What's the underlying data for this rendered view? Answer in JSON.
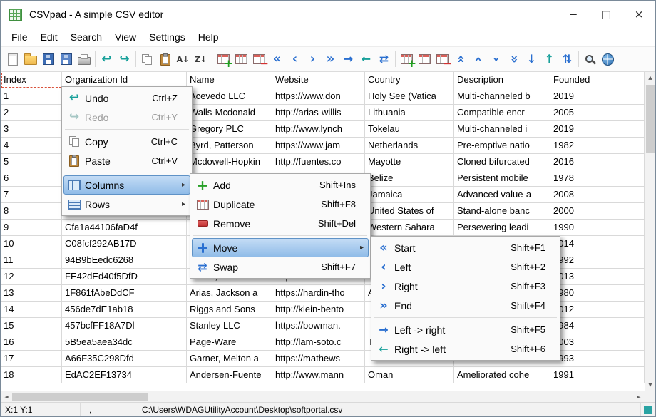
{
  "window": {
    "title": "CSVpad - A simple CSV editor",
    "controls": {
      "minimize": "−",
      "maximize": "□",
      "close": "×"
    }
  },
  "menubar": {
    "items": [
      "File",
      "Edit",
      "Search",
      "View",
      "Settings",
      "Help"
    ]
  },
  "toolbar": {
    "groups": [
      [
        {
          "name": "new-file-button",
          "icon": "new-file-icon"
        },
        {
          "name": "open-button",
          "icon": "open-icon"
        },
        {
          "name": "save-button",
          "icon": "save-icon"
        },
        {
          "name": "save-as-button",
          "icon": "save-as-icon"
        },
        {
          "name": "print-button",
          "icon": "print-icon"
        }
      ],
      [
        {
          "name": "undo-button",
          "icon": "undo-icon"
        },
        {
          "name": "redo-button",
          "icon": "redo-icon"
        }
      ],
      [
        {
          "name": "copy-button",
          "icon": "copy-icon"
        },
        {
          "name": "paste-button",
          "icon": "paste-icon"
        },
        {
          "name": "sort-asc-button",
          "icon": "sort-asc-icon"
        },
        {
          "name": "sort-desc-button",
          "icon": "sort-desc-icon"
        }
      ],
      [
        {
          "name": "col-add-button",
          "icon": "table-add-icon"
        },
        {
          "name": "col-duplicate-button",
          "icon": "table-icon"
        },
        {
          "name": "col-remove-button",
          "icon": "table-remove-icon"
        },
        {
          "name": "col-move-start-button",
          "icon": "move-start-icon"
        },
        {
          "name": "col-move-left-button",
          "icon": "move-left-icon"
        },
        {
          "name": "col-move-right-button",
          "icon": "move-right-icon"
        },
        {
          "name": "col-move-end-button",
          "icon": "move-end-icon"
        },
        {
          "name": "col-shift-right-button",
          "icon": "arrow-right-icon"
        },
        {
          "name": "col-shift-left-button",
          "icon": "arrow-left-icon"
        },
        {
          "name": "col-swap-button",
          "icon": "swap-h-icon"
        }
      ],
      [
        {
          "name": "row-add-button",
          "icon": "table-add-icon"
        },
        {
          "name": "row-duplicate-button",
          "icon": "table-icon"
        },
        {
          "name": "row-remove-button",
          "icon": "table-remove-icon"
        },
        {
          "name": "row-move-top-button",
          "icon": "move-top-icon"
        },
        {
          "name": "row-move-up-button",
          "icon": "move-up-icon"
        },
        {
          "name": "row-move-down-button",
          "icon": "move-down-icon"
        },
        {
          "name": "row-move-bottom-button",
          "icon": "move-bottom-icon"
        },
        {
          "name": "row-shift-down-button",
          "icon": "arrow-down-icon"
        },
        {
          "name": "row-shift-up-button",
          "icon": "arrow-up-icon"
        },
        {
          "name": "row-swap-button",
          "icon": "swap-v-icon"
        }
      ],
      [
        {
          "name": "search-button",
          "icon": "search-icon"
        },
        {
          "name": "web-button",
          "icon": "globe-icon"
        }
      ]
    ]
  },
  "table": {
    "columns": [
      "Index",
      "Organization Id",
      "Name",
      "Website",
      "Country",
      "Description",
      "Founded"
    ],
    "rows": [
      [
        "1",
        "",
        "Acevedo LLC",
        "https://www.don",
        "Holy See (Vatica",
        "Multi-channeled b",
        "2019"
      ],
      [
        "2",
        "",
        "Walls-Mcdonald",
        "http://arias-willis",
        "Lithuania",
        "Compatible encr",
        "2005"
      ],
      [
        "3",
        "",
        "Gregory PLC",
        "http://www.lynch",
        "Tokelau",
        "Multi-channeled i",
        "2019"
      ],
      [
        "4",
        "",
        "Byrd, Patterson",
        "https://www.jam",
        "Netherlands",
        "Pre-emptive natio",
        "1982"
      ],
      [
        "5",
        "",
        "Mcdowell-Hopkin",
        "http://fuentes.co",
        "Mayotte",
        "Cloned bifurcated",
        "2016"
      ],
      [
        "6",
        "",
        "",
        "",
        "Belize",
        "Persistent mobile",
        "1978"
      ],
      [
        "7",
        "",
        "",
        "",
        "Jamaica",
        "Advanced value-a",
        "2008"
      ],
      [
        "8",
        "",
        "",
        "",
        "United States of",
        "Stand-alone banc",
        "2000"
      ],
      [
        "9",
        "Cfa1a44106faD4f",
        "",
        "",
        "Western Sahara",
        "Persevering leadi",
        "1990"
      ],
      [
        "10",
        "C08fcf292AB17D",
        "",
        "",
        "",
        "",
        "2014"
      ],
      [
        "11",
        "94B9bEedc6268",
        "",
        "",
        "",
        "",
        "1992"
      ],
      [
        "12",
        "FE42dEd40f5DfD",
        "Lester, Ochoa a",
        "http://www.mund",
        "",
        "",
        "2013"
      ],
      [
        "13",
        "1F861fAbeDdCF",
        "Arias, Jackson a",
        "https://hardin-tho",
        "A",
        "",
        "1980"
      ],
      [
        "14",
        "456de7dE1ab18",
        "Riggs and Sons",
        "http://klein-bento",
        "",
        "",
        "2012"
      ],
      [
        "15",
        "457bcfFF18A7Dl",
        "Stanley LLC",
        "https://bowman.",
        "",
        "",
        "1984"
      ],
      [
        "16",
        "5B5ea5aea34dc",
        "Page-Ware",
        "http://lam-soto.c",
        "T",
        "",
        "2003"
      ],
      [
        "17",
        "A66F35C298Dfd",
        "Garner, Melton a",
        "https://mathews",
        "",
        "",
        "1993"
      ],
      [
        "18",
        "EdAC2EF13734",
        "Andersen-Fuente",
        "http://www.mann",
        "Oman",
        "Ameliorated cohe",
        "1991"
      ]
    ]
  },
  "menus": {
    "context": {
      "items": [
        {
          "label": "Undo",
          "shortcut": "Ctrl+Z",
          "icon": "undo-icon"
        },
        {
          "label": "Redo",
          "shortcut": "Ctrl+Y",
          "icon": "redo-disabled-icon",
          "disabled": true
        },
        {
          "type": "separator"
        },
        {
          "label": "Copy",
          "shortcut": "Ctrl+C",
          "icon": "copy-icon"
        },
        {
          "label": "Paste",
          "shortcut": "Ctrl+V",
          "icon": "paste-icon"
        },
        {
          "type": "separator"
        },
        {
          "label": "Columns",
          "icon": "columns-icon",
          "submenu": true,
          "highlighted": true
        },
        {
          "label": "Rows",
          "icon": "rows-icon",
          "submenu": true
        }
      ]
    },
    "columns": {
      "items": [
        {
          "label": "Add",
          "shortcut": "Shift+Ins",
          "icon": "add-icon"
        },
        {
          "label": "Duplicate",
          "shortcut": "Shift+F8",
          "icon": "table-icon"
        },
        {
          "label": "Remove",
          "shortcut": "Shift+Del",
          "icon": "remove-icon"
        },
        {
          "type": "separator"
        },
        {
          "label": "Move",
          "icon": "move-cross-icon",
          "submenu": true,
          "highlighted": true
        },
        {
          "label": "Swap",
          "shortcut": "Shift+F7",
          "icon": "swap-h-icon"
        }
      ]
    },
    "move": {
      "items": [
        {
          "label": "Start",
          "shortcut": "Shift+F1",
          "icon": "move-start-icon"
        },
        {
          "label": "Left",
          "shortcut": "Shift+F2",
          "icon": "move-left-icon"
        },
        {
          "label": "Right",
          "shortcut": "Shift+F3",
          "icon": "move-right-icon"
        },
        {
          "label": "End",
          "shortcut": "Shift+F4",
          "icon": "move-end-icon"
        },
        {
          "type": "separator"
        },
        {
          "label": "Left -> right",
          "shortcut": "Shift+F5",
          "icon": "arrow-right-icon"
        },
        {
          "label": "Right -> left",
          "shortcut": "Shift+F6",
          "icon": "arrow-left-icon"
        }
      ]
    }
  },
  "statusbar": {
    "cell_position": "X:1 Y:1",
    "delimiter": ",",
    "file_path": "C:\\Users\\WDAGUtilityAccount\\Desktop\\softportal.csv"
  },
  "colors": {
    "menu_highlight": "#90bce8",
    "accent_blue": "#2a6fd0",
    "accent_teal": "#18a09a",
    "accent_green": "#27a027",
    "accent_red": "#d43030",
    "cursor_outline": "#d9503a"
  }
}
